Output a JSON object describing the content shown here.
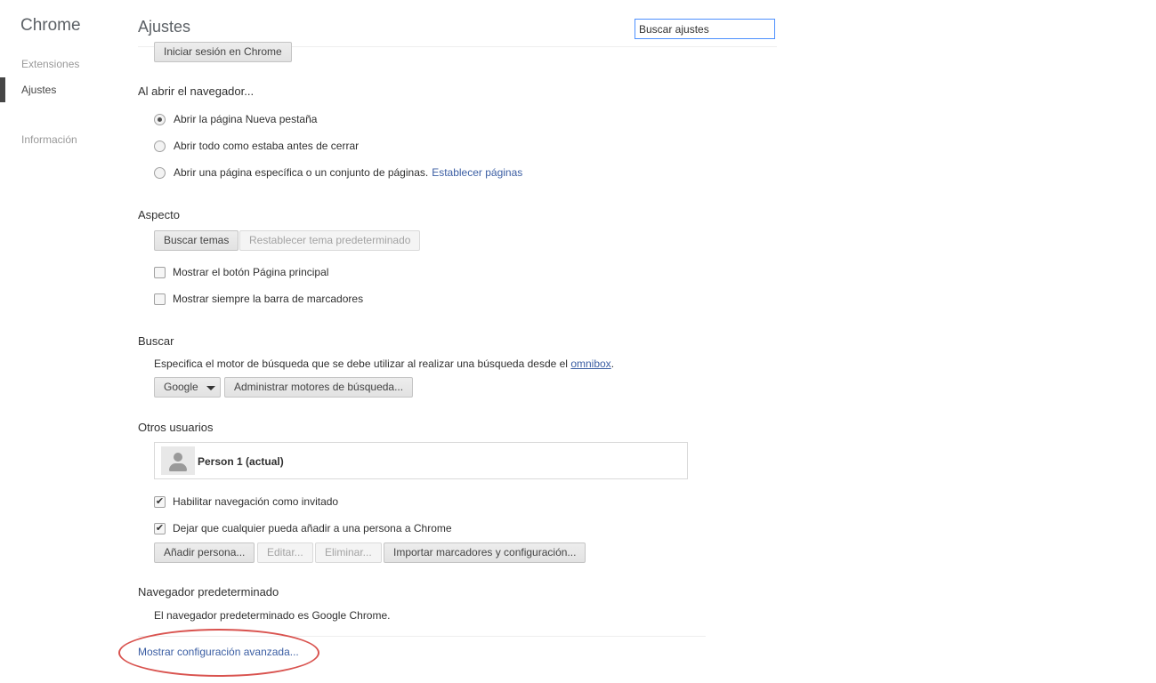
{
  "sidebar": {
    "title": "Chrome",
    "items": [
      {
        "label": "Extensiones"
      },
      {
        "label": "Ajustes"
      },
      {
        "label": "Información"
      }
    ]
  },
  "header": {
    "title": "Ajustes",
    "search_placeholder": "Buscar ajustes"
  },
  "signin": {
    "button": "Iniciar sesión en Chrome"
  },
  "startup": {
    "title": "Al abrir el navegador...",
    "options": [
      "Abrir la página Nueva pestaña",
      "Abrir todo como estaba antes de cerrar",
      "Abrir una página específica o un conjunto de páginas."
    ],
    "set_pages_link": "Establecer páginas"
  },
  "appearance": {
    "title": "Aspecto",
    "get_themes": "Buscar temas",
    "reset_theme": "Restablecer tema predeterminado",
    "show_home_button": "Mostrar el botón Página principal",
    "show_bookmarks_bar": "Mostrar siempre la barra de marcadores"
  },
  "search": {
    "title": "Buscar",
    "description": "Especifica el motor de búsqueda que se debe utilizar al realizar una búsqueda desde el",
    "omnibox_link": "omnibox",
    "period": ".",
    "engine_selected": "Google",
    "manage_button": "Administrar motores de búsqueda..."
  },
  "people": {
    "title": "Otros usuarios",
    "current_user": "Person 1 (actual)",
    "guest_browsing": "Habilitar navegación como invitado",
    "anyone_add": "Dejar que cualquier pueda añadir a una persona a Chrome",
    "add_button": "Añadir persona...",
    "edit_button": "Editar...",
    "remove_button": "Eliminar...",
    "import_button": "Importar marcadores y configuración..."
  },
  "default_browser": {
    "title": "Navegador predeterminado",
    "status": "El navegador predeterminado es Google Chrome."
  },
  "advanced_link": "Mostrar configuración avanzada...",
  "colors": {
    "link": "#3b5ea3",
    "highlight": "#d9534f",
    "search_focus": "#4d90fe"
  }
}
